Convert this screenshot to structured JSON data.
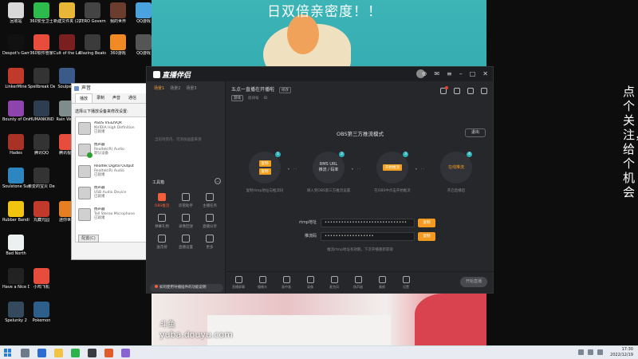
{
  "overlay": {
    "banner": "日双倍亲密度！！",
    "vertical": "点个关注，给个机会",
    "watermark_brand": "斗鱼",
    "watermark_url": "yuba.douyu.com"
  },
  "desktop_icons": [
    {
      "label": "回收站",
      "color": "#d8d8d8"
    },
    {
      "label": "360安全卫士",
      "color": "#2dbb4d"
    },
    {
      "label": "新建文件夹 (2)",
      "color": "#e8b737"
    },
    {
      "label": "ZERO Govern.exe",
      "color": "#444"
    },
    {
      "label": "我的世界",
      "color": "#6a3d2f"
    },
    {
      "label": "QQ游戏",
      "color": "#4aa3df"
    },
    {
      "label": "Despot's Game",
      "color": "#111"
    },
    {
      "label": "360软件管家",
      "color": "#e74c3c"
    },
    {
      "label": "Cult of the Lamb",
      "color": "#7a1f1f"
    },
    {
      "label": "Blazing Beaks",
      "color": "#3b3b3b"
    },
    {
      "label": "360游戏",
      "color": "#f08a24"
    },
    {
      "label": "QQ游戏",
      "color": "#555"
    },
    {
      "label": "LinkerMine",
      "color": "#c0392b"
    },
    {
      "label": "Spellbreak Demonica",
      "color": "#333"
    },
    {
      "label": "Soulpeak",
      "color": "#3a5a8a"
    },
    {
      "label": "Bounty of One",
      "color": "#8e44ad"
    },
    {
      "label": "HUMANKIND",
      "color": "#2c3e50"
    },
    {
      "label": "Rain World",
      "color": "#7f8c8d"
    },
    {
      "label": "Hades",
      "color": "#a93226"
    },
    {
      "label": "腾讯QQ",
      "color": "#333"
    },
    {
      "label": "腾讯视频",
      "color": "#e74c3c"
    },
    {
      "label": "Soulstone Survivors",
      "color": "#2e86c1"
    },
    {
      "label": "亲爱的宝贝 Demo",
      "color": "#333"
    },
    {
      "label": "Rubber Bandits",
      "color": "#f1c40f"
    },
    {
      "label": "丸藏元园",
      "color": "#c0392b"
    },
    {
      "label": "迷你世界",
      "color": "#e67e22"
    },
    {
      "label": "Have a Nice Death",
      "color": "#222"
    },
    {
      "label": "小鸡飞机",
      "color": "#e74c3c"
    },
    {
      "label": "Bad North",
      "color": "#ecf0f1"
    },
    {
      "label": "Pokemon",
      "color": "#2d5f8a"
    },
    {
      "label": "Spelunky 2",
      "color": "#34495e"
    }
  ],
  "sound_dialog": {
    "title": "声音",
    "tabs": [
      "播放",
      "录制",
      "声音",
      "通信"
    ],
    "description": "选择以下播放设备来修改设置:",
    "devices": [
      {
        "name": "ASUS VS32VQR",
        "sub1": "NVIDIA High Definition",
        "sub2": "已就绪",
        "ok": false
      },
      {
        "name": "扬声器",
        "sub1": "Realtek(R) Audio",
        "sub2": "默认设备",
        "ok": true
      },
      {
        "name": "Realtek Digital Output",
        "sub1": "Realtek(R) Audio",
        "sub2": "已就绪",
        "ok": false
      },
      {
        "name": "扬声器",
        "sub1": "USB Audio Device",
        "sub2": "已就绪",
        "ok": false
      },
      {
        "name": "扬声器",
        "sub1": "Tell Stereo Microphone",
        "sub2": "已就绪",
        "ok": false
      }
    ],
    "configure_btn": "配置(C)"
  },
  "app": {
    "logo": "直播伴侣",
    "scene_tabs": [
      "场景1",
      "场景2",
      "场景3"
    ],
    "scene_hint": "当前场景内，可添加画面来源",
    "tools_title": "工具箱",
    "tools": [
      {
        "label": "OBS推流",
        "active": true
      },
      {
        "label": "房管助手",
        "active": false
      },
      {
        "label": "主播任务",
        "active": false
      },
      {
        "label": "弹幕礼物",
        "active": false
      },
      {
        "label": "录像回放",
        "active": false
      },
      {
        "label": "直播分享",
        "active": false
      },
      {
        "label": "送花榜",
        "active": false
      },
      {
        "label": "直播设置",
        "active": false
      },
      {
        "label": "更多",
        "active": false
      }
    ],
    "notice": "如何使用导播插件的功能说明",
    "room_title": "五点一直播在开播啦",
    "room_edit": "修改",
    "category": "游戏",
    "room_meta": [
      "房间号",
      "ID"
    ],
    "obs_title": "OBS第三方推流模式",
    "exit_btn": "退出",
    "steps": [
      {
        "num": "1",
        "tag1": "复制",
        "tag2": "复制",
        "caption": "复制rtmp地址与推流码"
      },
      {
        "num": "2",
        "plain1": "RMS URL",
        "plain2": "推流 / 码率",
        "caption": "填入到OBS第三方推流设置"
      },
      {
        "num": "3",
        "tag1": "开始推流",
        "caption": "在OBS中点击开始推流"
      },
      {
        "num": "4",
        "plain1": "在线推流",
        "caption": "开启直播后"
      }
    ],
    "rtmp_label": "rtmp地址",
    "rtmp_value": "••••••••••••••••••••••••••••••",
    "key_label": "推流码",
    "key_value": "••••••••••••••••••",
    "copy_btn": "复制",
    "form_hint": "推流rtmp地址有效期，下次开播重新获取",
    "bottom_items": [
      "直播屏幕",
      "摄像头",
      "画中画",
      "录像",
      "麦克风",
      "扬声器",
      "美颜",
      "设置"
    ],
    "start_btn": "开始直播"
  },
  "taskbar": {
    "time": "17:30",
    "date": "2022/12/19"
  }
}
